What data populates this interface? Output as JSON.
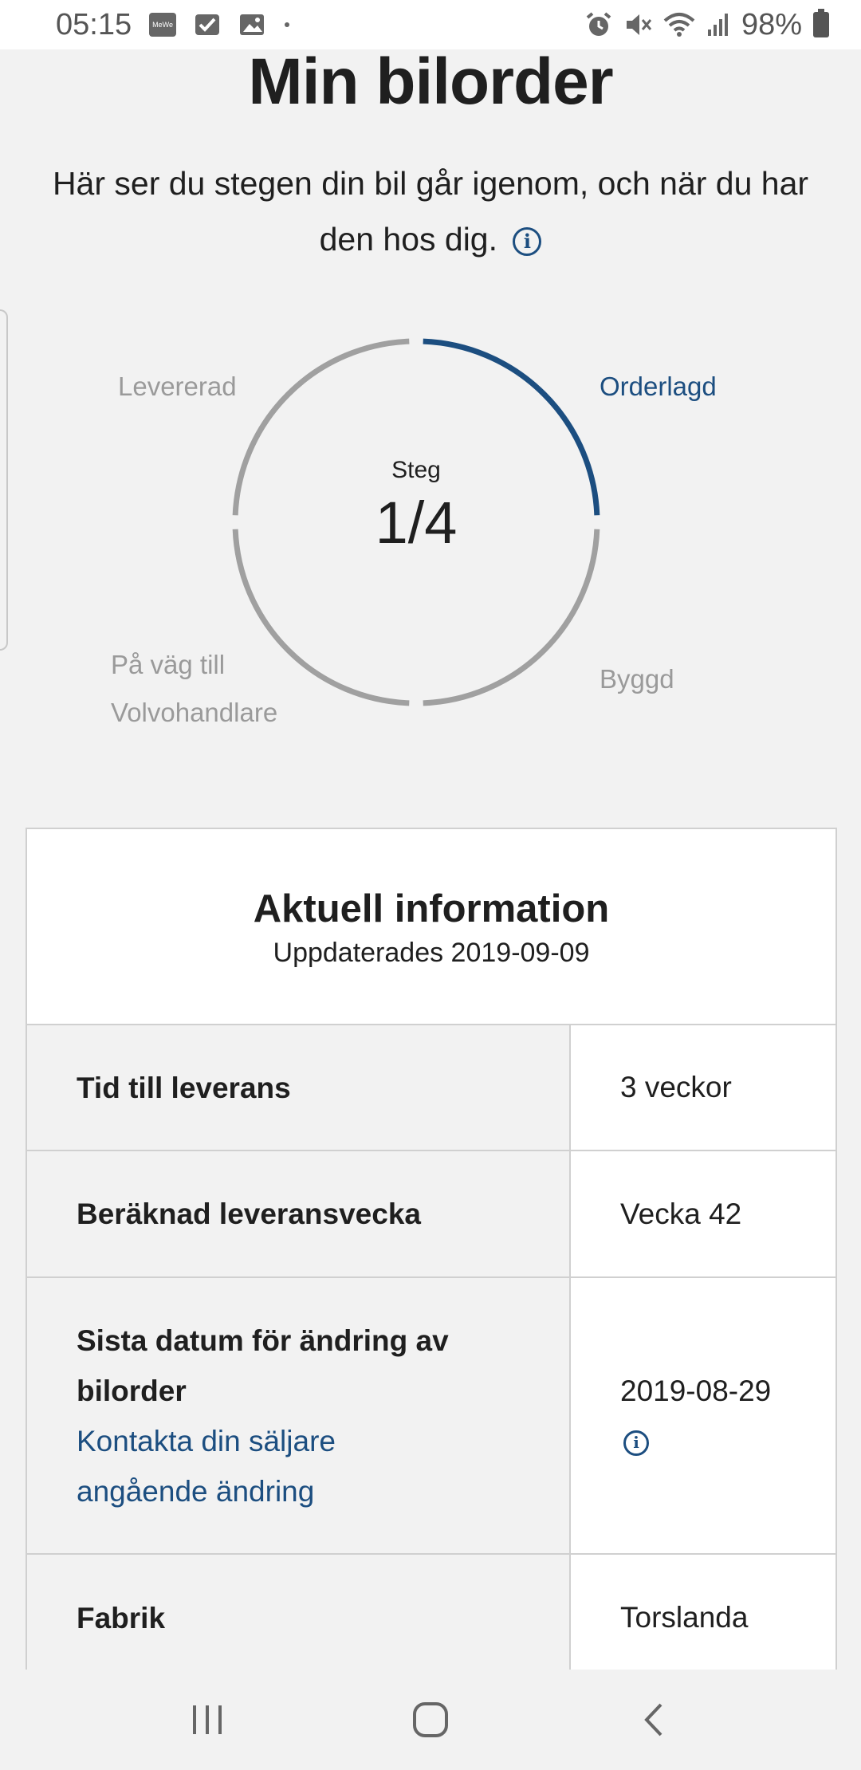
{
  "status_bar": {
    "time": "05:15",
    "left_icons": [
      "mewe-app-icon",
      "check-icon",
      "image-icon",
      "dot-icon"
    ],
    "right_icons": [
      "alarm-icon",
      "mute-icon",
      "wifi-icon",
      "signal-icon"
    ],
    "battery": "98%"
  },
  "page": {
    "title": "Min bilorder",
    "intro": "Här ser du stegen din bil går igenom, och när du har den hos dig."
  },
  "progress": {
    "step_label": "Steg",
    "step_value": "1/4",
    "current_step": 1,
    "total_steps": 4,
    "active_color": "#1c4e80",
    "inactive_color": "#a0a0a0",
    "labels": {
      "orderlagd": "Orderlagd",
      "byggd": "Byggd",
      "pa_vag_1": "På väg till",
      "pa_vag_2": "Volvohandlare",
      "levererad": "Levererad"
    }
  },
  "card": {
    "title": "Aktuell information",
    "subtitle": "Uppdaterades 2019-09-09",
    "rows": [
      {
        "label": "Tid till leverans",
        "value": "3 veckor"
      },
      {
        "label": "Beräknad leveransvecka",
        "value": "Vecka 42"
      },
      {
        "label": "Sista datum för ändring av bilorder",
        "link": "Kontakta din säljare angående ändring",
        "value": "2019-08-29"
      },
      {
        "label": "Fabrik",
        "value": "Torslanda"
      }
    ]
  },
  "colors": {
    "accent": "#1c4e80",
    "background": "#f2f2f2",
    "muted": "#9a9a9a"
  }
}
